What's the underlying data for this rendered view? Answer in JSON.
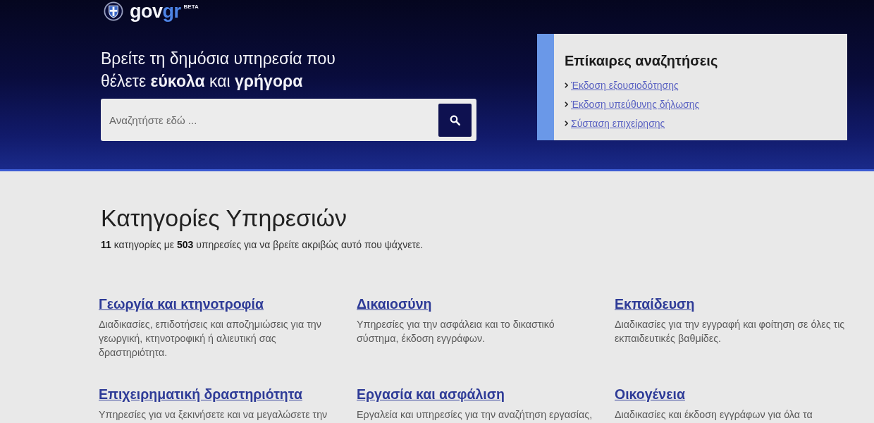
{
  "header": {
    "logo": {
      "parts": [
        {
          "text": "gov",
          "color": "#f4f5fb"
        },
        {
          "text": "gr",
          "color": "#4d84e6"
        }
      ],
      "badge": "BETA"
    },
    "headline": "Βρείτε τη δημόσια υπηρεσία που θέλετε **εύκολα** και **γρήγορα**",
    "search": {
      "placeholder": "Αναζητήστε εδώ ..."
    }
  },
  "trending": {
    "title": "Επίκαιρες αναζητήσεις",
    "links": [
      "Έκδοση εξουσιοδότησης",
      "Έκδοση υπεύθυνης δήλωσης",
      "Σύσταση επιχείρησης"
    ]
  },
  "categories": {
    "title": "Κατηγορίες Υπηρεσιών",
    "summary": "**11** κατηγορίες με **503** υπηρεσίες για να βρείτε ακριβώς αυτό που ψάχνετε.",
    "items": [
      {
        "title": "Γεωργία και κτηνοτροφία",
        "description": "Διαδικασίες, επιδοτήσεις και αποζημιώσεις για την γεωργική, κτηνοτροφική ή αλιευτική σας δραστηριότητα."
      },
      {
        "title": "Δικαιοσύνη",
        "description": "Υπηρεσίες για την ασφάλεια και το δικαστικό σύστημα, έκδοση εγγράφων."
      },
      {
        "title": "Εκπαίδευση",
        "description": "Διαδικασίες για την εγγραφή και φοίτηση σε όλες τις εκπαιδευτικές βαθμίδες."
      },
      {
        "title": "Επιχειρηματική δραστηριότητα",
        "description": "Υπηρεσίες για να ξεκινήσετε και να μεγαλώσετε την"
      },
      {
        "title": "Εργασία και ασφάλιση",
        "description": "Εργαλεία και υπηρεσίες για την αναζήτηση εργασίας,"
      },
      {
        "title": "Οικογένεια",
        "description": "Διαδικασίες και έκδοση εγγράφων για όλα τα"
      }
    ]
  }
}
